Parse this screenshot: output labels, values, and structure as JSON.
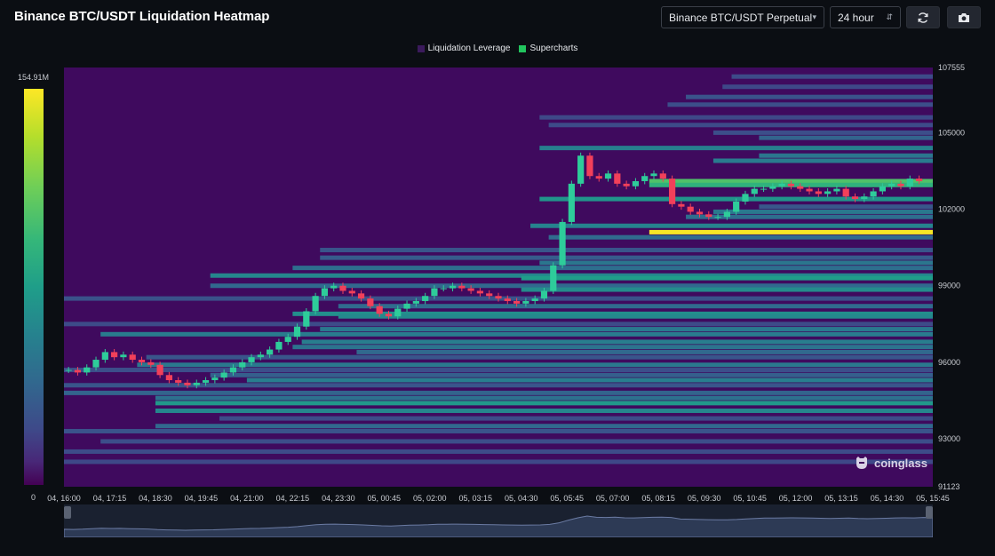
{
  "header": {
    "title": "Binance BTC/USDT Liquidation Heatmap",
    "symbol_select": "Binance BTC/USDT Perpetual",
    "range_select": "24 hour",
    "refresh_icon": "refresh-icon",
    "camera_icon": "camera-icon"
  },
  "legend": [
    {
      "label": "Liquidation Leverage",
      "color": "#3b1a5c"
    },
    {
      "label": "Supercharts",
      "color": "#22c55e"
    }
  ],
  "colorbar": {
    "max_label": "154.91M",
    "min_label": "0"
  },
  "watermark": {
    "text": "coinglass",
    "icon": "coinglass-logo-icon"
  },
  "chart_data": {
    "type": "heatmap",
    "title": "Binance BTC/USDT Liquidation Heatmap",
    "x_tick_labels": [
      "04, 16:00",
      "04, 17:15",
      "04, 18:30",
      "04, 19:45",
      "04, 21:00",
      "04, 22:15",
      "04, 23:30",
      "05, 00:45",
      "05, 02:00",
      "05, 03:15",
      "05, 04:30",
      "05, 05:45",
      "05, 07:00",
      "05, 08:15",
      "05, 09:30",
      "05, 10:45",
      "05, 12:00",
      "05, 13:15",
      "05, 14:30",
      "05, 15:45"
    ],
    "y_tick_labels": [
      "107555",
      "105000",
      "102000",
      "99000",
      "96000",
      "93000",
      "91123"
    ],
    "ylim": [
      91123,
      107555
    ],
    "colorscale": {
      "min": 0,
      "max": 154.91,
      "unit": "M"
    },
    "background_color": "#3f0a5e",
    "price_series": {
      "interval_minutes": 15,
      "start": "04, 16:00",
      "close": [
        95700,
        95600,
        95800,
        96100,
        96400,
        96200,
        96300,
        96100,
        96000,
        95900,
        95500,
        95300,
        95200,
        95100,
        95200,
        95300,
        95400,
        95600,
        95800,
        96000,
        96200,
        96300,
        96500,
        96800,
        97000,
        97400,
        98000,
        98600,
        98900,
        99000,
        98800,
        98700,
        98500,
        98200,
        97900,
        97800,
        98100,
        98300,
        98400,
        98600,
        98900,
        98900,
        99000,
        98900,
        98800,
        98700,
        98600,
        98500,
        98400,
        98300,
        98400,
        98500,
        98800,
        99800,
        101500,
        103000,
        104100,
        103300,
        103200,
        103400,
        103000,
        102900,
        103100,
        103300,
        103400,
        103200,
        102200,
        102100,
        101900,
        101800,
        101700,
        101700,
        101900,
        102300,
        102600,
        102800,
        102800,
        102900,
        103000,
        102900,
        102800,
        102700,
        102600,
        102700,
        102800,
        102500,
        102400,
        102500,
        102700,
        102900,
        103000,
        102900,
        103200,
        103100
      ]
    },
    "bands": [
      {
        "price": 107200,
        "x_start": "05, 10:15",
        "value": 40
      },
      {
        "price": 106800,
        "x_start": "05, 10:00",
        "value": 38
      },
      {
        "price": 106400,
        "x_start": "05, 09:00",
        "value": 45
      },
      {
        "price": 106100,
        "x_start": "05, 08:30",
        "value": 42
      },
      {
        "price": 105600,
        "x_start": "05, 05:00",
        "value": 38
      },
      {
        "price": 105300,
        "x_start": "05, 05:15",
        "value": 40
      },
      {
        "price": 105000,
        "x_start": "05, 09:45",
        "value": 42
      },
      {
        "price": 104800,
        "x_start": "05, 11:00",
        "value": 55
      },
      {
        "price": 104400,
        "x_start": "05, 05:00",
        "value": 75
      },
      {
        "price": 104100,
        "x_start": "05, 11:00",
        "value": 68
      },
      {
        "price": 103900,
        "x_start": "05, 09:45",
        "value": 72
      },
      {
        "price": 103100,
        "x_start": "05, 08:00",
        "value": 125
      },
      {
        "price": 102950,
        "x_start": "05, 08:00",
        "value": 112
      },
      {
        "price": 102400,
        "x_start": "05, 05:00",
        "value": 90
      },
      {
        "price": 102100,
        "x_start": "05, 11:00",
        "value": 48
      },
      {
        "price": 101900,
        "x_start": "05, 09:45",
        "value": 70
      },
      {
        "price": 101700,
        "x_start": "05, 09:00",
        "value": 62
      },
      {
        "price": 101350,
        "x_start": "05, 04:45",
        "value": 78
      },
      {
        "price": 101100,
        "x_start": "05, 08:00",
        "value": 154
      },
      {
        "price": 100900,
        "x_start": "05, 05:15",
        "value": 60
      },
      {
        "price": 100400,
        "x_start": "04, 23:00",
        "value": 46
      },
      {
        "price": 100100,
        "x_start": "04, 23:00",
        "value": 50
      },
      {
        "price": 99900,
        "x_start": "05, 05:00",
        "value": 68
      },
      {
        "price": 99700,
        "x_start": "04, 22:15",
        "value": 62
      },
      {
        "price": 99400,
        "x_start": "04, 20:00",
        "value": 80
      },
      {
        "price": 99300,
        "x_start": "05, 04:30",
        "value": 96
      },
      {
        "price": 99000,
        "x_start": "04, 20:00",
        "value": 58
      },
      {
        "price": 98850,
        "x_start": "05, 04:30",
        "value": 84
      },
      {
        "price": 98500,
        "x_start": "04, 16:00",
        "value": 44
      },
      {
        "price": 98200,
        "x_start": "04, 23:30",
        "value": 60
      },
      {
        "price": 97900,
        "x_start": "04, 22:15",
        "value": 86
      },
      {
        "price": 97800,
        "x_start": "04, 23:30",
        "value": 82
      },
      {
        "price": 97500,
        "x_start": "04, 16:00",
        "value": 40
      },
      {
        "price": 97300,
        "x_start": "04, 23:00",
        "value": 70
      },
      {
        "price": 97100,
        "x_start": "04, 17:00",
        "value": 72
      },
      {
        "price": 96800,
        "x_start": "04, 22:30",
        "value": 74
      },
      {
        "price": 96600,
        "x_start": "04, 22:15",
        "value": 66
      },
      {
        "price": 96400,
        "x_start": "05, 00:00",
        "value": 58
      },
      {
        "price": 96200,
        "x_start": "04, 18:15",
        "value": 46
      },
      {
        "price": 95900,
        "x_start": "04, 18:00",
        "value": 70
      },
      {
        "price": 95700,
        "x_start": "04, 16:00",
        "value": 42
      },
      {
        "price": 95500,
        "x_start": "04, 20:00",
        "value": 52
      },
      {
        "price": 95300,
        "x_start": "04, 21:00",
        "value": 74
      },
      {
        "price": 95100,
        "x_start": "04, 16:00",
        "value": 46
      },
      {
        "price": 94800,
        "x_start": "04, 16:00",
        "value": 55
      },
      {
        "price": 94600,
        "x_start": "04, 18:30",
        "value": 64
      },
      {
        "price": 94400,
        "x_start": "04, 18:30",
        "value": 92
      },
      {
        "price": 94100,
        "x_start": "04, 18:30",
        "value": 80
      },
      {
        "price": 93800,
        "x_start": "04, 20:15",
        "value": 40
      },
      {
        "price": 93500,
        "x_start": "04, 18:30",
        "value": 58
      },
      {
        "price": 93300,
        "x_start": "04, 16:00",
        "value": 45
      },
      {
        "price": 92900,
        "x_start": "04, 17:00",
        "value": 42
      },
      {
        "price": 92500,
        "x_start": "04, 16:00",
        "value": 40
      },
      {
        "price": 92100,
        "x_start": "04, 16:00",
        "value": 38
      }
    ]
  }
}
